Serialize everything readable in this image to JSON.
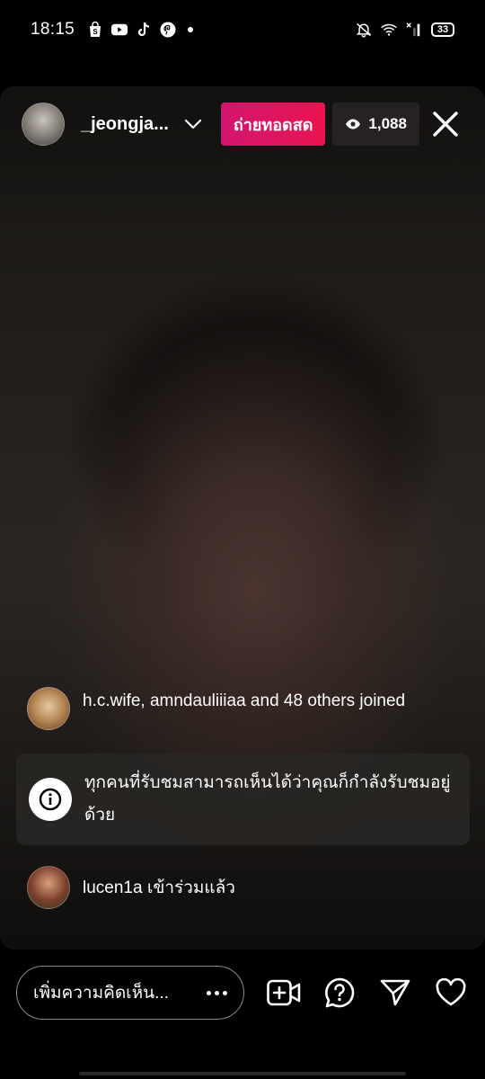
{
  "status_bar": {
    "time": "18:15",
    "left_icons": [
      "shop-icon",
      "youtube-icon",
      "tiktok-icon",
      "pinterest-icon",
      "dot-icon"
    ],
    "right_icons": [
      "mute-icon",
      "wifi-icon",
      "no-signal-icon"
    ],
    "battery": "33"
  },
  "live": {
    "username": "_jeongja...",
    "live_badge": "ถ่ายทอดสด",
    "viewer_count": "1,088"
  },
  "comments": {
    "joined_summary": "h.c.wife, amndauliiiaa and 48 others joined",
    "info_notice": "ทุกคนที่รับชมสามารถเห็นได้ว่าคุณก็กำลังรับชมอยู่ด้วย",
    "joined_user": "lucen1a เข้าร่วมแล้ว"
  },
  "bottom_bar": {
    "comment_placeholder": "เพิ่มความคิดเห็น...",
    "icons": [
      "add-video-icon",
      "question-icon",
      "send-icon",
      "heart-icon"
    ]
  }
}
